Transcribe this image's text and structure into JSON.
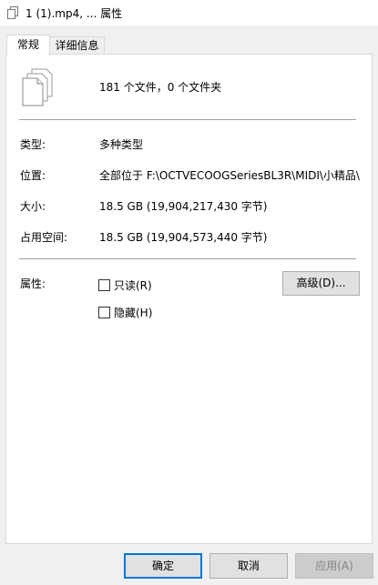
{
  "window": {
    "title": "1 (1).mp4, ... 属性",
    "title_icon": "multiple-files-icon"
  },
  "tabs": [
    {
      "label": "常规",
      "active": true
    },
    {
      "label": "详细信息",
      "active": false
    }
  ],
  "general": {
    "icon": "multiple-documents-icon",
    "summary": "181 个文件，0 个文件夹",
    "rows": [
      {
        "label": "类型:",
        "value": "多种类型"
      },
      {
        "label": "位置:",
        "value": "全部位于 F:\\OCTVECOOGSeriesBL3R\\MIDI\\小精品\\"
      },
      {
        "label": "大小:",
        "value": "18.5 GB (19,904,217,430 字节)"
      },
      {
        "label": "占用空间:",
        "value": "18.5 GB (19,904,573,440 字节)"
      }
    ],
    "attributes": {
      "label": "属性:",
      "readonly": {
        "label": "只读(R)",
        "checked": false
      },
      "hidden": {
        "label": "隐藏(H)",
        "checked": false
      },
      "advanced_button": "高级(D)..."
    }
  },
  "buttons": {
    "ok": "确定",
    "cancel": "取消",
    "apply": "应用(A)"
  },
  "colors": {
    "accent": "#0078d7",
    "button_face": "#e1e1e1",
    "disabled_text": "#838383"
  }
}
